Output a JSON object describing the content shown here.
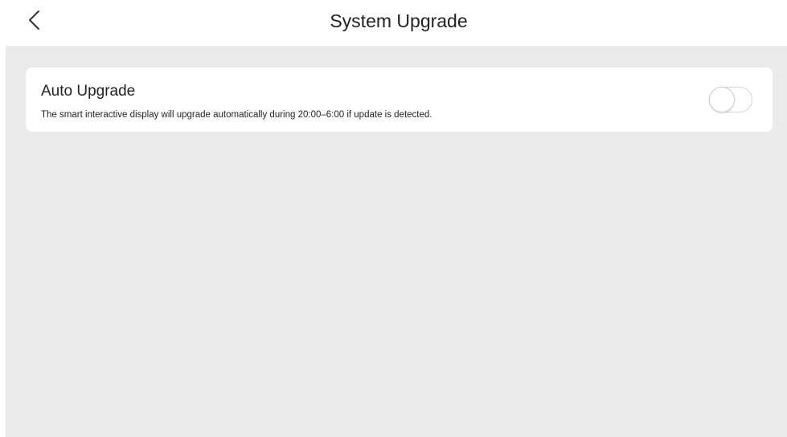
{
  "header": {
    "title": "System Upgrade",
    "back_icon": "chevron-left-icon"
  },
  "auto_upgrade": {
    "title": "Auto Upgrade",
    "description": "The smart interactive display will upgrade automatically during 20:00–6:00 if update is detected.",
    "enabled": false
  },
  "colors": {
    "background": "#ebebeb",
    "card": "#ffffff",
    "text": "#222222",
    "toggle_border": "#d6d6d6"
  }
}
